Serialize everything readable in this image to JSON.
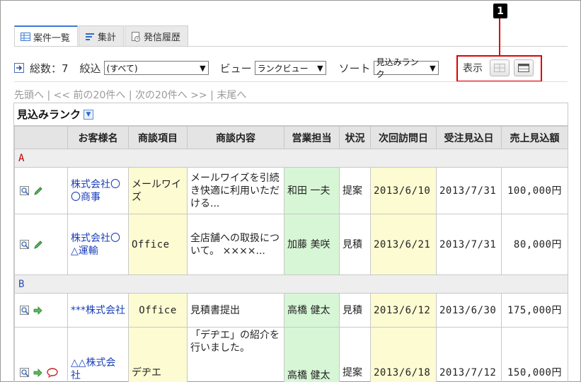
{
  "tabs": [
    {
      "label": "案件一覧",
      "icon": "table-icon"
    },
    {
      "label": "集計",
      "icon": "list-icon"
    },
    {
      "label": "発信履歴",
      "icon": "history-icon"
    }
  ],
  "toolbar": {
    "total_label": "総数：7",
    "filter_label": "絞込",
    "filter_value": "(すべて)",
    "view_label": "ビュー",
    "view_value": "ランクビュー",
    "sort_label": "ソート",
    "sort_value": "見込みランク",
    "display_label": "表示",
    "callout_number": "1"
  },
  "pager": {
    "first": "先頭へ",
    "prev": "<< 前の20件へ",
    "next": "次の20件へ >>",
    "last": "末尾へ"
  },
  "grid": {
    "title": "見込みランク",
    "headers": [
      "",
      "お客様名",
      "商談項目",
      "商談内容",
      "営業担当",
      "状況",
      "次回訪問日",
      "受注見込日",
      "売上見込額"
    ],
    "groups": [
      {
        "label": "A",
        "rows": [
          {
            "customer": "株式会社〇〇商事",
            "item": "メールワイズ",
            "content": "メールワイズを引続き快適に利用いただける...",
            "rep": "和田 一夫",
            "status": "提案",
            "next_visit": "2013/6/10",
            "order_date": "2013/7/31",
            "amount": "100,000円"
          },
          {
            "customer": "株式会社〇△運輸",
            "item": "Office",
            "content": "全店舗への取扱について。 ××××...",
            "rep": "加藤 美咲",
            "status": "見積",
            "next_visit": "2013/6/21",
            "order_date": "2013/7/31",
            "amount": "80,000円"
          }
        ]
      },
      {
        "label": "B",
        "rows": [
          {
            "customer": "***株式会社",
            "item": "Office",
            "content": "見積書提出",
            "rep": "高橋 健太",
            "status": "見積",
            "next_visit": "2013/6/12",
            "order_date": "2013/6/30",
            "amount": "175,000円"
          },
          {
            "customer": "△△株式会社",
            "item": "デヂエ",
            "content": "「デヂエ」の紹介を行いました。",
            "rep": "高橋 健太",
            "status": "提案",
            "next_visit": "2013/6/18",
            "order_date": "2013/7/12",
            "amount": "150,000円"
          }
        ]
      }
    ]
  }
}
